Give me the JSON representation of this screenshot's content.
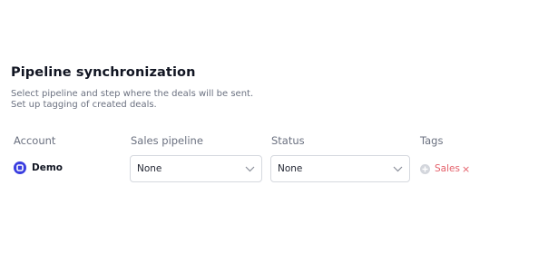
{
  "section": {
    "title": "Pipeline synchronization",
    "description_line1": "Select pipeline and step where the deals will be sent.",
    "description_line2": "Set up tagging of created deals."
  },
  "columns": {
    "account": "Account",
    "sales_pipeline": "Sales pipeline",
    "status": "Status",
    "tags": "Tags"
  },
  "row": {
    "account_name": "Demo",
    "account_icon": "account-logo-icon",
    "sales_pipeline_value": "None",
    "status_value": "None",
    "tags": [
      {
        "label": "Sales",
        "remove_glyph": "×"
      }
    ]
  },
  "colors": {
    "account_icon": "#3a3ee0",
    "tag_text": "#e4606a",
    "muted_text": "#6b7180"
  }
}
